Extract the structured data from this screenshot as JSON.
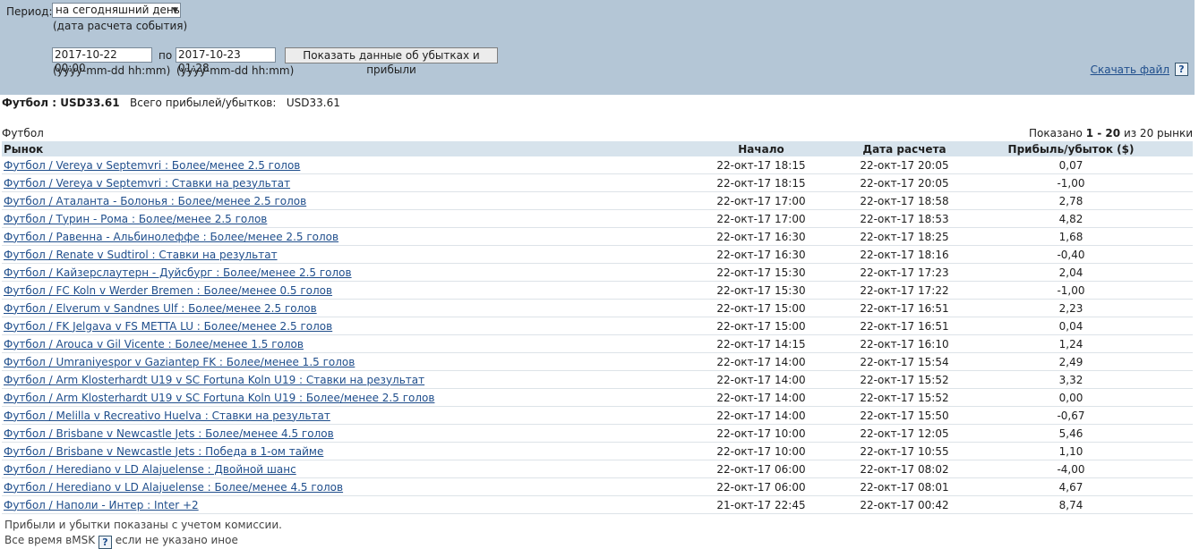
{
  "filter": {
    "period_label": "Период:",
    "period_value": "на сегодняшний день",
    "period_note": "(дата расчета события)",
    "from_value": "2017-10-22 00:00",
    "between_label": "по",
    "to_value": "2017-10-23 01:28",
    "from_format": "(yyyy-mm-dd hh:mm)",
    "to_format": "(yyyy-mm-dd hh:mm)",
    "submit_label": "Показать данные об убытках и прибыли",
    "download_label": "Скачать файл",
    "help_label": "?"
  },
  "summary": {
    "sport_total": "Футбол : USD33.61",
    "total_label": "Всего прибылей/убытков:",
    "total_value": "USD33.61"
  },
  "section": {
    "label": "Футбол",
    "shown_prefix": "Показано",
    "shown_range": "1 - 20",
    "shown_suffix": "из 20 рынки"
  },
  "table": {
    "headers": {
      "market": "Рынок",
      "start": "Начало",
      "settle": "Дата расчета",
      "pl": "Прибыль/убыток ($)"
    },
    "rows": [
      {
        "market": "Футбол / Vereya v Septemvri : Более/менее 2.5 голов",
        "start": "22-окт-17 18:15",
        "settle": "22-окт-17 20:05",
        "pl": "0,07"
      },
      {
        "market": "Футбол / Vereya v Septemvri : Ставки на результат",
        "start": "22-окт-17 18:15",
        "settle": "22-окт-17 20:05",
        "pl": "-1,00"
      },
      {
        "market": "Футбол / Аталанта - Болонья : Более/менее 2.5 голов",
        "start": "22-окт-17 17:00",
        "settle": "22-окт-17 18:58",
        "pl": "2,78"
      },
      {
        "market": "Футбол / Турин - Рома : Более/менее 2.5 голов",
        "start": "22-окт-17 17:00",
        "settle": "22-окт-17 18:53",
        "pl": "4,82"
      },
      {
        "market": "Футбол / Равенна - Альбинолеффе : Более/менее 2.5 голов",
        "start": "22-окт-17 16:30",
        "settle": "22-окт-17 18:25",
        "pl": "1,68"
      },
      {
        "market": "Футбол / Renate v Sudtirol : Ставки на результат",
        "start": "22-окт-17 16:30",
        "settle": "22-окт-17 18:16",
        "pl": "-0,40"
      },
      {
        "market": "Футбол / Кайзерслаутерн - Дуйсбург : Более/менее 2.5 голов",
        "start": "22-окт-17 15:30",
        "settle": "22-окт-17 17:23",
        "pl": "2,04"
      },
      {
        "market": "Футбол / FC Koln v Werder Bremen : Более/менее 0.5 голов",
        "start": "22-окт-17 15:30",
        "settle": "22-окт-17 17:22",
        "pl": "-1,00"
      },
      {
        "market": "Футбол / Elverum v Sandnes Ulf : Более/менее 2.5 голов",
        "start": "22-окт-17 15:00",
        "settle": "22-окт-17 16:51",
        "pl": "2,23"
      },
      {
        "market": "Футбол / FK Jelgava v FS METTA LU : Более/менее 2.5 голов",
        "start": "22-окт-17 15:00",
        "settle": "22-окт-17 16:51",
        "pl": "0,04"
      },
      {
        "market": "Футбол / Arouca v Gil Vicente : Более/менее 1.5 голов",
        "start": "22-окт-17 14:15",
        "settle": "22-окт-17 16:10",
        "pl": "1,24"
      },
      {
        "market": "Футбол / Umraniyespor v Gaziantep FK : Более/менее 1.5 голов",
        "start": "22-окт-17 14:00",
        "settle": "22-окт-17 15:54",
        "pl": "2,49"
      },
      {
        "market": "Футбол / Arm Klosterhardt U19 v SC Fortuna Koln U19 : Ставки на результат",
        "start": "22-окт-17 14:00",
        "settle": "22-окт-17 15:52",
        "pl": "3,32"
      },
      {
        "market": "Футбол / Arm Klosterhardt U19 v SC Fortuna Koln U19 : Более/менее 2.5 голов",
        "start": "22-окт-17 14:00",
        "settle": "22-окт-17 15:52",
        "pl": "0,00"
      },
      {
        "market": "Футбол / Melilla v Recreativo Huelva : Ставки на результат",
        "start": "22-окт-17 14:00",
        "settle": "22-окт-17 15:50",
        "pl": "-0,67"
      },
      {
        "market": "Футбол / Brisbane v Newcastle Jets : Более/менее 4.5 голов",
        "start": "22-окт-17 10:00",
        "settle": "22-окт-17 12:05",
        "pl": "5,46"
      },
      {
        "market": "Футбол / Brisbane v Newcastle Jets : Победа в 1-ом тайме",
        "start": "22-окт-17 10:00",
        "settle": "22-окт-17 10:55",
        "pl": "1,10"
      },
      {
        "market": "Футбол / Herediano v LD Alajuelense : Двойной шанс",
        "start": "22-окт-17 06:00",
        "settle": "22-окт-17 08:02",
        "pl": "-4,00"
      },
      {
        "market": "Футбол / Herediano v LD Alajuelense : Более/менее 4.5 голов",
        "start": "22-окт-17 06:00",
        "settle": "22-окт-17 08:01",
        "pl": "4,67"
      },
      {
        "market": "Футбол / Наполи - Интер : Inter +2",
        "start": "21-окт-17 22:45",
        "settle": "22-окт-17 00:42",
        "pl": "8,74"
      }
    ]
  },
  "footer": {
    "commission_note": "Прибыли и убытки показаны с учетом комиссии.",
    "time_note_prefix": "Все время вMSK",
    "time_note_suffix": "если не указано иное",
    "help_label": "?"
  }
}
